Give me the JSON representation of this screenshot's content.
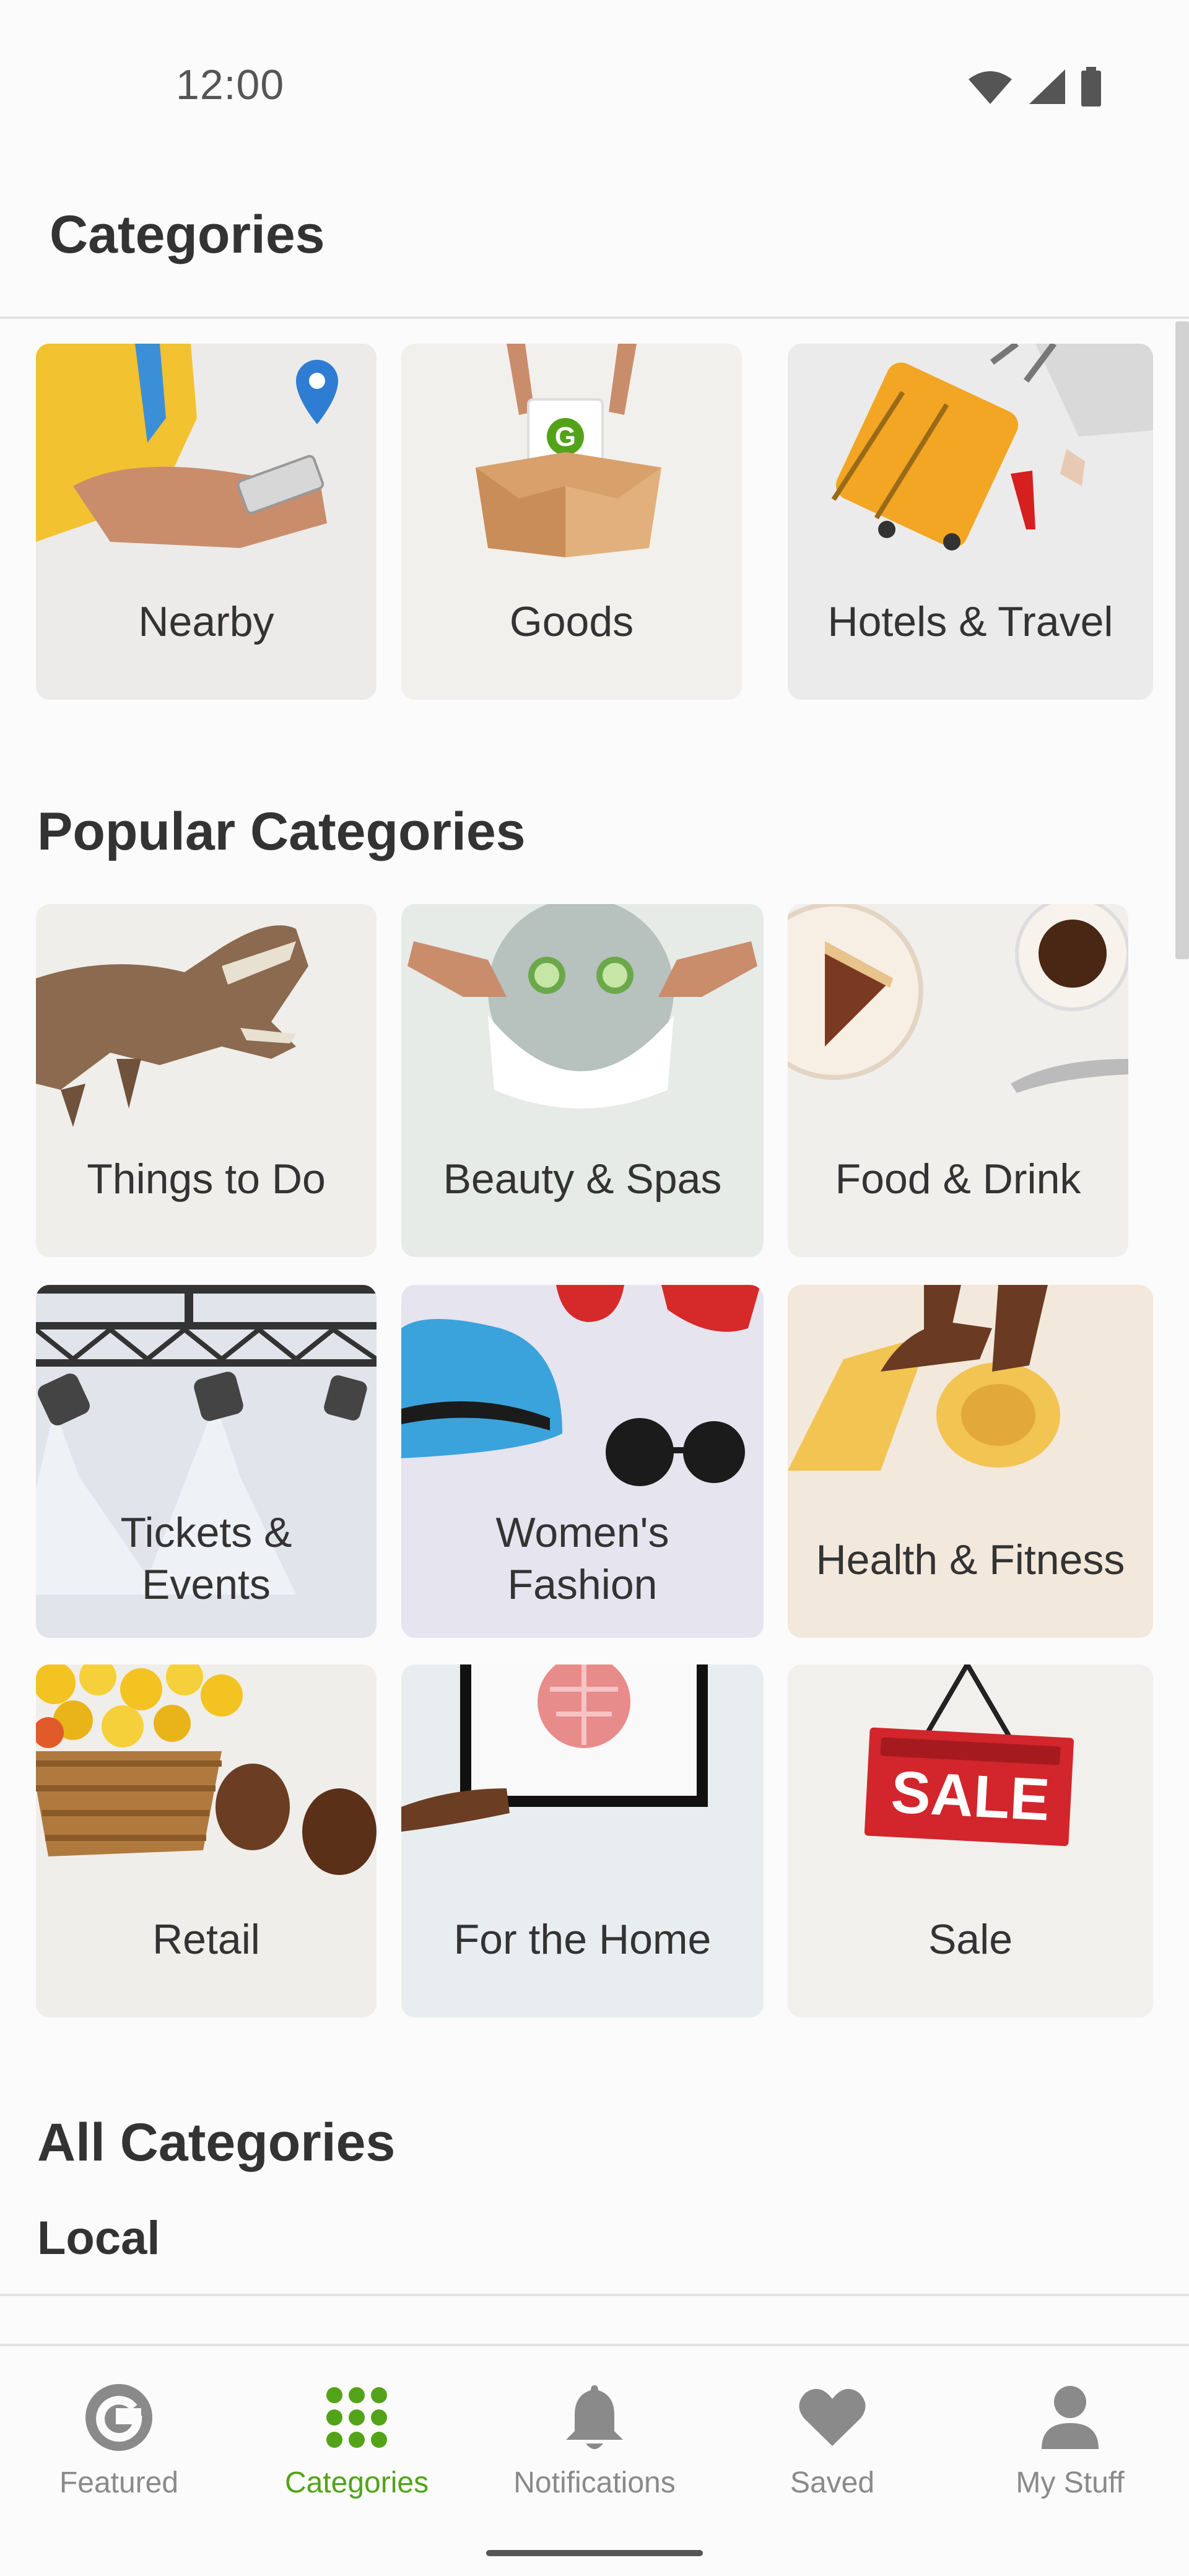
{
  "status_bar": {
    "time": "12:00"
  },
  "header": {
    "title": "Categories"
  },
  "featured_tiles": [
    {
      "label": "Nearby",
      "icon": "location-pin-icon"
    },
    {
      "label": "Goods",
      "icon": "box-icon"
    },
    {
      "label": "Hotels & Travel",
      "icon": "suitcase-icon"
    }
  ],
  "popular": {
    "title": "Popular Categories",
    "items": [
      {
        "label": "Things to Do"
      },
      {
        "label": "Beauty & Spas"
      },
      {
        "label": "Food & Drink"
      },
      {
        "label_lines": [
          "Tickets &",
          "Events"
        ]
      },
      {
        "label_lines": [
          "Women's",
          "Fashion"
        ]
      },
      {
        "label": "Health & Fitness"
      },
      {
        "label": "Retail"
      },
      {
        "label": "For the Home"
      },
      {
        "label": "Sale",
        "sign_text": "SALE"
      }
    ]
  },
  "all_categories": {
    "title": "All Categories",
    "first_group": "Local"
  },
  "bottom_nav": {
    "items": [
      {
        "label": "Featured",
        "icon": "groupon-g-icon",
        "active": false
      },
      {
        "label": "Categories",
        "icon": "grid-icon",
        "active": true
      },
      {
        "label": "Notifications",
        "icon": "bell-icon",
        "active": false
      },
      {
        "label": "Saved",
        "icon": "heart-icon",
        "active": false
      },
      {
        "label": "My Stuff",
        "icon": "person-icon",
        "active": false
      }
    ]
  },
  "colors": {
    "accent": "#53a318",
    "inactive": "#8a8a8a",
    "tile_bg": "#f0efed"
  }
}
